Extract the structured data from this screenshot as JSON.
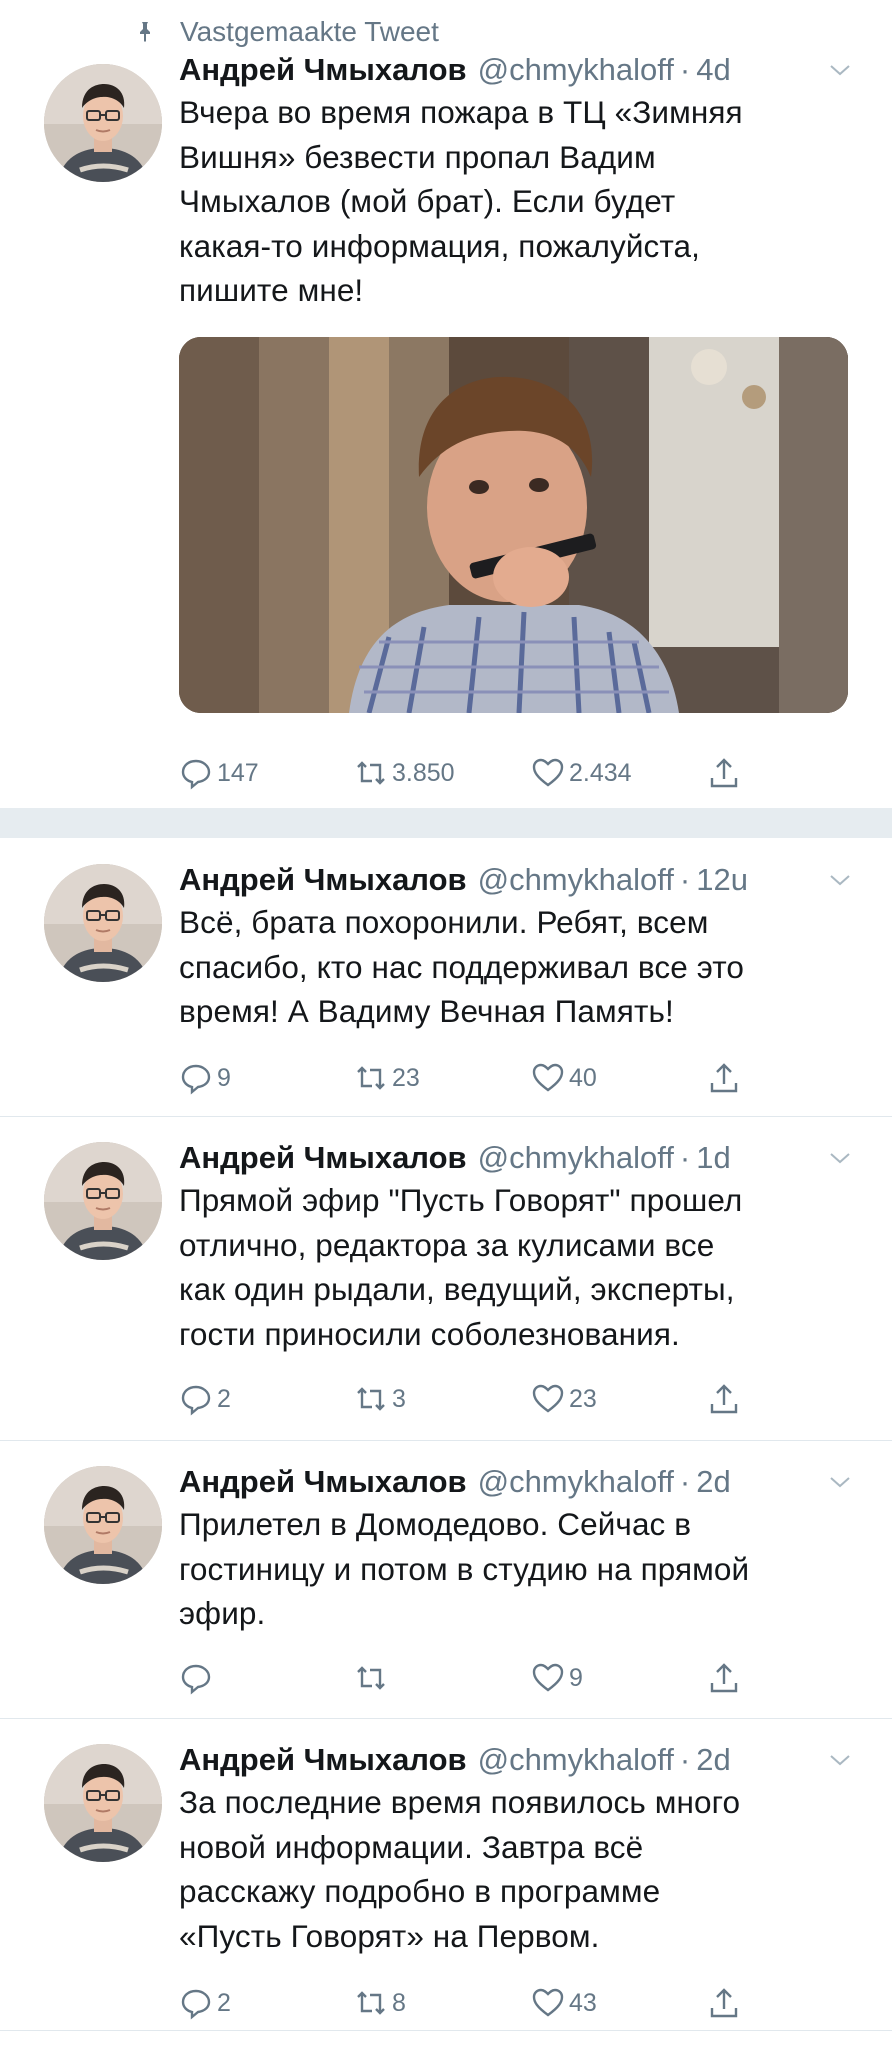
{
  "pinned_label": "Vastgemaakte Tweet",
  "icons": {
    "pin": "pin-icon",
    "more": "chevron-down-icon",
    "reply": "reply-icon",
    "retweet": "retweet-icon",
    "like": "heart-icon",
    "share": "share-icon"
  },
  "colors": {
    "secondary_text": "#657786",
    "divider": "#e1e8ed",
    "section_gap": "#e6ecf0"
  },
  "tweets": [
    {
      "name": "Андрей Чмыхалов",
      "handle": "@chmykhaloff",
      "time": "4d",
      "text": "Вчера во время пожара в ТЦ «Зимняя\nВишня» безвести пропал Вадим\nЧмыхалов (мой брат). Если будет\nкакая-то информация, пожалуйста,\nпишите мне!",
      "replies": "147",
      "retweets": "3.850",
      "likes": "2.434"
    },
    {
      "name": "Андрей Чмыхалов",
      "handle": "@chmykhaloff",
      "time": "12u",
      "text": "Всё, брата похоронили. Ребят, всем\nспасибо, кто нас поддерживал все это\nвремя! А Вадиму Вечная Память!",
      "replies": "9",
      "retweets": "23",
      "likes": "40"
    },
    {
      "name": "Андрей Чмыхалов",
      "handle": "@chmykhaloff",
      "time": "1d",
      "text": "Прямой эфир \"Пусть Говорят\" прошел\nотлично, редактора за кулисами все\nкак один рыдали, ведущий, эксперты,\nгости приносили соболезнования.",
      "replies": "2",
      "retweets": "3",
      "likes": "23"
    },
    {
      "name": "Андрей Чмыхалов",
      "handle": "@chmykhaloff",
      "time": "2d",
      "text": "Прилетел в Домодедово. Сейчас в\nгостиницу и потом в студию на прямой\nэфир.",
      "replies": "",
      "retweets": "",
      "likes": "9"
    },
    {
      "name": "Андрей Чмыхалов",
      "handle": "@chmykhaloff",
      "time": "2d",
      "text": "За последние время появилось много\nновой информации. Завтра всё\nрасскажу подробно в программе\n«Пусть Говорят» на Первом.",
      "replies": "2",
      "retweets": "8",
      "likes": "43"
    }
  ]
}
